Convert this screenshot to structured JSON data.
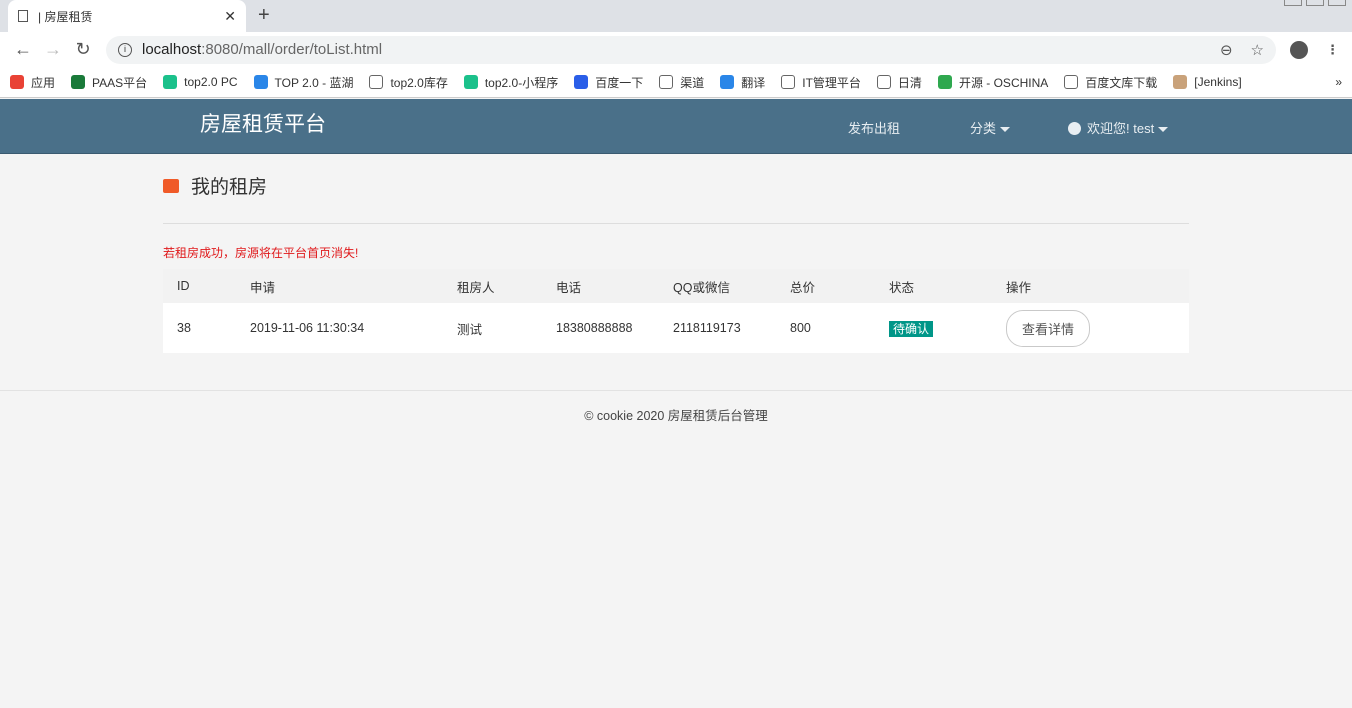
{
  "browser": {
    "tab_title": "| 房屋租赁",
    "url_host": "localhost",
    "url_path": ":8080/mall/order/toList.html",
    "bookmarks": [
      {
        "label": "应用",
        "color": "#e94235"
      },
      {
        "label": "PAAS平台",
        "color": "#1a7a3a"
      },
      {
        "label": "top2.0 PC",
        "color": "#1bc18b"
      },
      {
        "label": "TOP 2.0 - 蓝湖",
        "color": "#2a86e8"
      },
      {
        "label": "top2.0库存",
        "color": "#ffffff"
      },
      {
        "label": "top2.0-小程序",
        "color": "#1bc18b"
      },
      {
        "label": "百度一下",
        "color": "#2a5ee8"
      },
      {
        "label": "渠道",
        "color": "#ffffff"
      },
      {
        "label": "翻译",
        "color": "#2a86e8"
      },
      {
        "label": "IT管理平台",
        "color": "#ffffff"
      },
      {
        "label": "日清",
        "color": "#ffffff"
      },
      {
        "label": "开源 - OSCHINA",
        "color": "#2fa84f"
      },
      {
        "label": "百度文库下载",
        "color": "#ffffff"
      },
      {
        "label": "[Jenkins]",
        "color": "#c9a27a"
      }
    ],
    "more": "»"
  },
  "header": {
    "brand": "房屋租赁平台",
    "publish": "发布出租",
    "category": "分类",
    "user": "欢迎您! test"
  },
  "page": {
    "title": "我的租房",
    "warning": "若租房成功，房源将在平台首页消失!",
    "columns": [
      "ID",
      "申请",
      "租房人",
      "电话",
      "QQ或微信",
      "总价",
      "状态",
      "操作"
    ],
    "rows": [
      {
        "id": "38",
        "applied": "2019-11-06 11:30:34",
        "renter": "测试",
        "phone": "18380888888",
        "qq": "2118119173",
        "total": "800",
        "status": "待确认",
        "action": "查看详情"
      }
    ]
  },
  "footer": {
    "text": "© cookie 2020  房屋租赁后台管理"
  }
}
